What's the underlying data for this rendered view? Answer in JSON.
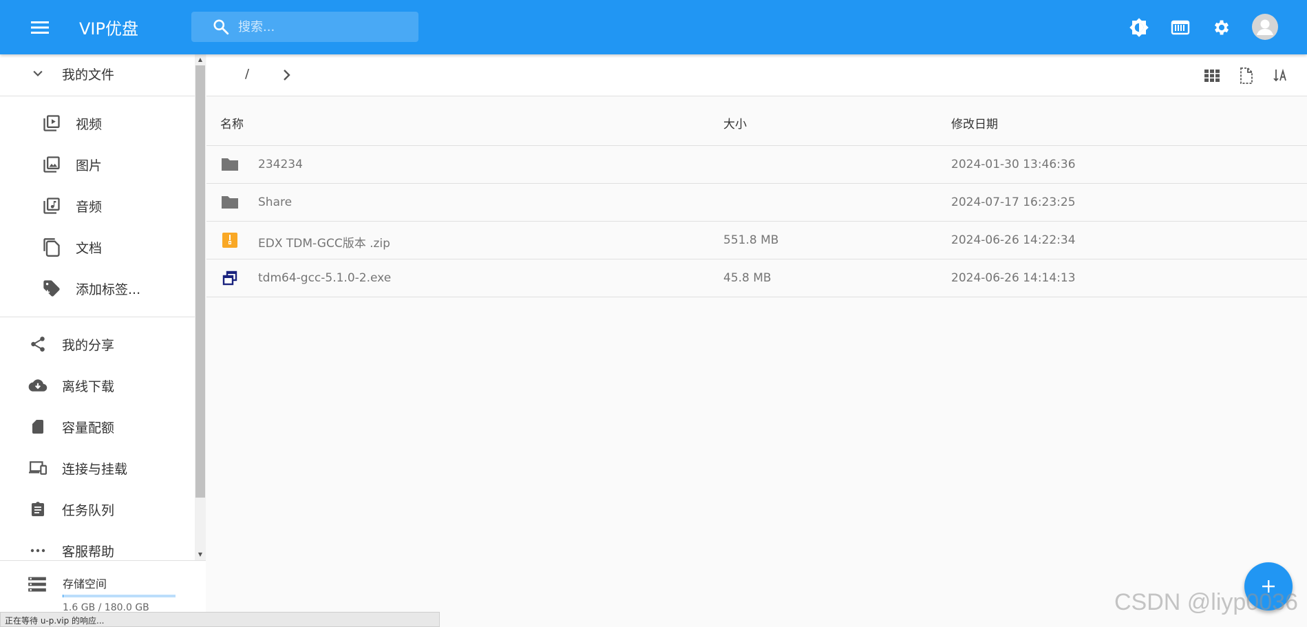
{
  "header": {
    "app_title": "VIP优盘",
    "search_placeholder": "搜索...",
    "icons": [
      "theme-icon",
      "transfer-icon",
      "settings-icon",
      "avatar-icon"
    ]
  },
  "sidebar": {
    "my_files": "我的文件",
    "sub_items": [
      {
        "label": "视频",
        "icon": "video-library-icon"
      },
      {
        "label": "图片",
        "icon": "photo-library-icon"
      },
      {
        "label": "音频",
        "icon": "music-library-icon"
      },
      {
        "label": "文档",
        "icon": "file-copy-icon"
      },
      {
        "label": "添加标签...",
        "icon": "tag-plus-icon"
      }
    ],
    "items": [
      {
        "label": "我的分享",
        "icon": "share-icon"
      },
      {
        "label": "离线下载",
        "icon": "cloud-download-icon"
      },
      {
        "label": "容量配额",
        "icon": "sd-card-icon"
      },
      {
        "label": "连接与挂载",
        "icon": "devices-icon"
      },
      {
        "label": "任务队列",
        "icon": "clipboard-icon"
      },
      {
        "label": "客服帮助",
        "icon": "more-icon"
      }
    ],
    "storage": {
      "label": "存储空间",
      "value": "1.6 GB / 180.0 GB",
      "used_fraction": 0.009
    }
  },
  "toolbar": {
    "path": "/",
    "icons": [
      "grid-view-icon",
      "page-size-icon",
      "sort-icon"
    ]
  },
  "table": {
    "headers": {
      "name": "名称",
      "size": "大小",
      "date": "修改日期"
    },
    "rows": [
      {
        "type": "folder",
        "name": "234234",
        "size": "",
        "date": "2024-01-30 13:46:36"
      },
      {
        "type": "folder",
        "name": "Share",
        "size": "",
        "date": "2024-07-17 16:23:25"
      },
      {
        "type": "zip",
        "name": "EDX TDM-GCC版本 .zip",
        "size": "551.8 MB",
        "date": "2024-06-26 14:22:34"
      },
      {
        "type": "exe",
        "name": "tdm64-gcc-5.1.0-2.exe",
        "size": "45.8 MB",
        "date": "2024-06-26 14:14:13"
      }
    ]
  },
  "status_bar": "正在等待 u-p.vip 的响应...",
  "watermark": "CSDN @liyp0036",
  "colors": {
    "primary": "#2196f3",
    "zip": "#f9a825",
    "exe": "#1a237e"
  }
}
